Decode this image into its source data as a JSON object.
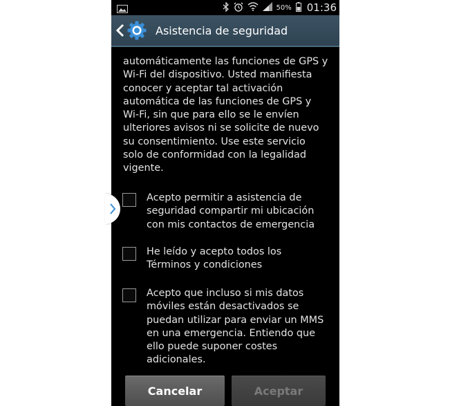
{
  "status_bar": {
    "battery_percent": "50%",
    "time": "01:36",
    "icons": [
      "gallery-icon",
      "bluetooth-icon",
      "alarm-icon",
      "wifi-icon",
      "signal-icon",
      "battery-icon"
    ]
  },
  "action_bar": {
    "title": "Asistencia de seguridad",
    "icon": "gear-icon"
  },
  "content": {
    "paragraph": "automáticamente las funciones de GPS y\nWi-Fi del dispositivo. Usted manifiesta\nconocer y aceptar tal activación\nautomática de las funciones de GPS y\nWi-Fi, sin que para ello se le envíen\nulteriores avisos ni se solicite de nuevo\nsu consentimiento. Use este servicio\nsolo de conformidad con la legalidad\nvigente.",
    "checkboxes": [
      {
        "label": "Acepto permitir a asistencia de\nseguridad compartir mi ubicación\ncon mis contactos de emergencia",
        "checked": false
      },
      {
        "label": "He leído y acepto todos los\nTérminos y condiciones",
        "checked": false
      },
      {
        "label": "Acepto que incluso si mis datos\nmóviles están desactivados se\npuedan utilizar para enviar un MMS\nen una emergencia. Entiendo que\nello puede suponer costes\nadicionales.",
        "checked": false
      }
    ]
  },
  "buttons": {
    "cancel_label": "Cancelar",
    "accept_label": "Aceptar",
    "accept_enabled": false
  },
  "colors": {
    "action_bar": "#344957",
    "background": "#000000",
    "text": "#e4e4e4",
    "cancel_button": "#5c5c5c",
    "accept_button_disabled": "#424242"
  }
}
